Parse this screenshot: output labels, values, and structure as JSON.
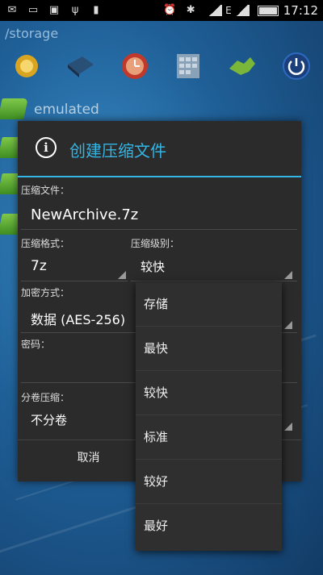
{
  "statusbar": {
    "time": "17:12",
    "network_label": "E"
  },
  "background": {
    "path": "/storage",
    "folder_name": "emulated"
  },
  "toolbar": {
    "icons": [
      "badge-icon",
      "book-icon",
      "clock-icon",
      "grid-icon",
      "puzzle-icon",
      "power-icon"
    ]
  },
  "dialog": {
    "title": "创建压缩文件",
    "archive_label": "压缩文件：",
    "archive_name": "NewArchive.7z",
    "format_label": "压缩格式：",
    "format_value": "7z",
    "level_label": "压缩级别：",
    "level_value": "较快",
    "encryption_label": "加密方式：",
    "encryption_value": "数据 (AES-256)",
    "password_label": "密码：",
    "split_label": "分卷压缩：",
    "split_value": "不分卷",
    "cancel_label": "取消"
  },
  "dropdown": {
    "options": [
      "存储",
      "最快",
      "较快",
      "标准",
      "较好",
      "最好"
    ]
  },
  "colors": {
    "accent": "#33b5e5",
    "dialog_bg": "#2b2b2b",
    "dropdown_bg": "#2f2f2f"
  }
}
